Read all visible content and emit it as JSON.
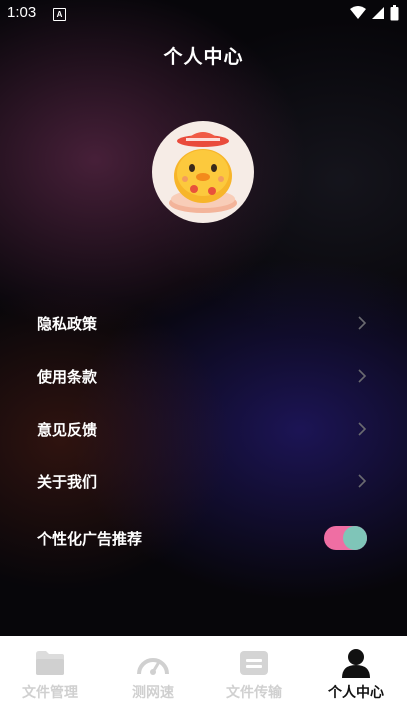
{
  "status_bar": {
    "time": "1:03",
    "badge": "A"
  },
  "header": {
    "title": "个人中心"
  },
  "menu": [
    {
      "label": "隐私政策"
    },
    {
      "label": "使用条款"
    },
    {
      "label": "意见反馈"
    },
    {
      "label": "关于我们"
    }
  ],
  "ad_toggle": {
    "label": "个性化广告推荐",
    "on": true
  },
  "bottom_nav": [
    {
      "label": "文件管理",
      "active": false
    },
    {
      "label": "测网速",
      "active": false
    },
    {
      "label": "文件传输",
      "active": false
    },
    {
      "label": "个人中心",
      "active": true
    }
  ],
  "colors": {
    "toggle_track": "#ef6ea3",
    "toggle_knob": "#7fc5b8",
    "nav_inactive": "#d0d0d0",
    "nav_active": "#111111"
  }
}
